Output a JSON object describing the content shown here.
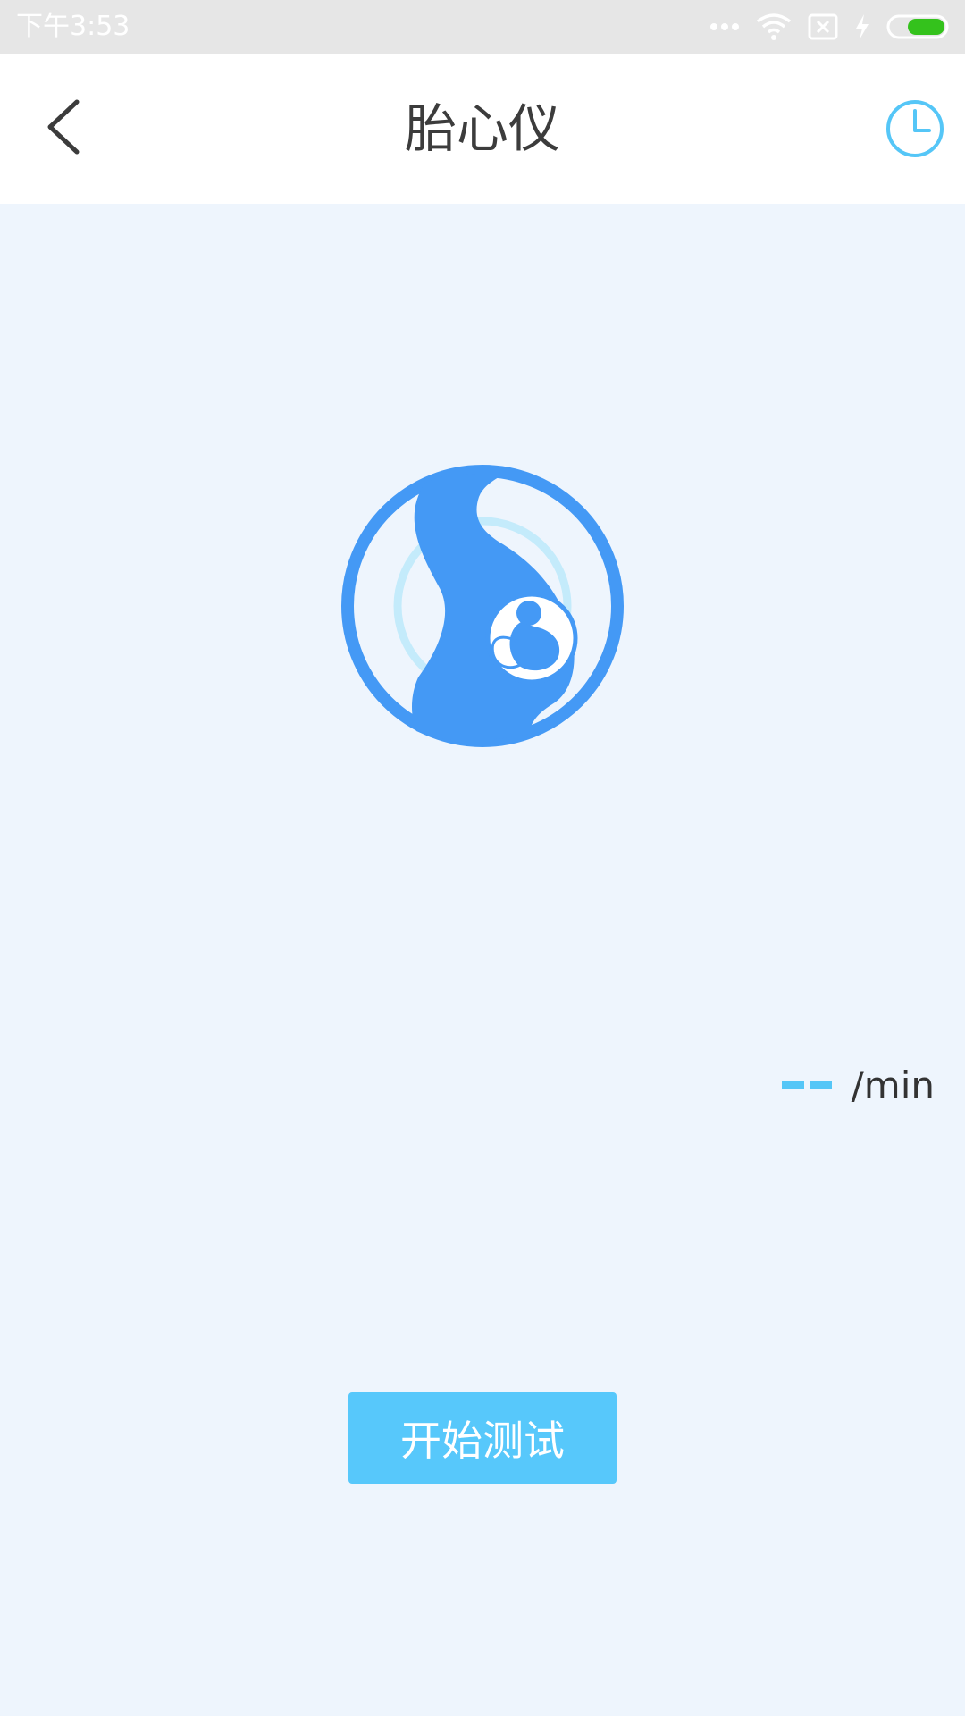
{
  "status_bar": {
    "time": "下午3:53",
    "icons": [
      "more-dots-icon",
      "wifi-icon",
      "sim-disabled-icon",
      "charging-icon",
      "battery-icon"
    ],
    "battery_color": "#34c21c"
  },
  "header": {
    "title": "胎心仪",
    "back_icon": "chevron-left-icon",
    "history_icon": "clock-icon"
  },
  "logo": {
    "icon": "pregnancy-fetus-icon",
    "color": "#4499f5",
    "ring_color": "#bfe9fb"
  },
  "heart_rate": {
    "value": "--",
    "unit": "/min"
  },
  "actions": {
    "start_label": "开始测试"
  },
  "colors": {
    "background": "#eef5fd",
    "accent": "#57c8fb",
    "primary_blue": "#4499f5"
  }
}
